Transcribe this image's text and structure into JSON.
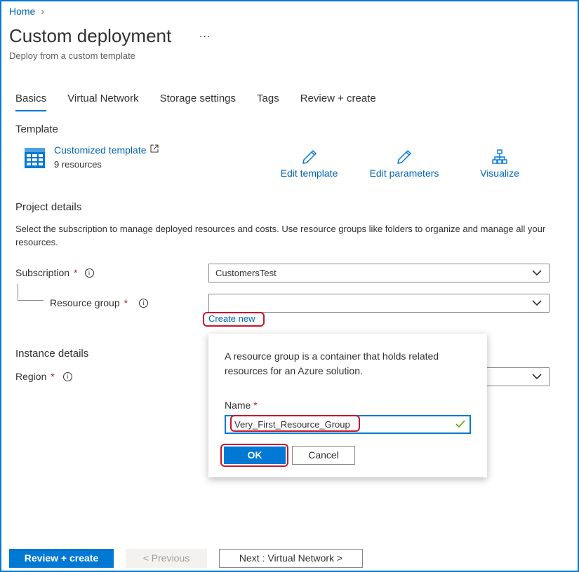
{
  "breadcrumb": {
    "home": "Home",
    "separator": "›"
  },
  "header": {
    "title": "Custom deployment",
    "more": "...",
    "subtitle": "Deploy from a custom template"
  },
  "tabs": [
    {
      "label": "Basics",
      "active": true
    },
    {
      "label": "Virtual Network",
      "active": false
    },
    {
      "label": "Storage settings",
      "active": false
    },
    {
      "label": "Tags",
      "active": false
    },
    {
      "label": "Review + create",
      "active": false
    }
  ],
  "template": {
    "heading": "Template",
    "name": "Customized template",
    "resources": "9 resources",
    "actions": {
      "edit_template": "Edit template",
      "edit_parameters": "Edit parameters",
      "visualize": "Visualize"
    }
  },
  "project": {
    "heading": "Project details",
    "description": "Select the subscription to manage deployed resources and costs. Use resource groups like folders to organize and manage all your resources.",
    "subscription_label": "Subscription",
    "subscription_value": "CustomersTest",
    "resource_group_label": "Resource group",
    "resource_group_value": "",
    "create_new": "Create new",
    "required_mark": "*",
    "info_glyph": "i"
  },
  "instance": {
    "heading": "Instance details",
    "region_label": "Region"
  },
  "popup": {
    "description": "A resource group is a container that holds related resources for an Azure solution.",
    "name_label": "Name",
    "name_value": "Very_First_Resource_Group",
    "ok": "OK",
    "cancel": "Cancel"
  },
  "footer": {
    "review_create": "Review + create",
    "previous": "< Previous",
    "next": "Next : Virtual Network >"
  },
  "colors": {
    "accent": "#0078d4",
    "link": "#0064b4",
    "required": "#a4262c",
    "highlight_ring": "#c4182c",
    "valid": "#57a300"
  },
  "icons": [
    "chevron-right-icon",
    "external-link-icon",
    "template-grid-icon",
    "pencil-icon",
    "hierarchy-icon",
    "chevron-down-icon",
    "info-icon",
    "checkmark-icon"
  ]
}
